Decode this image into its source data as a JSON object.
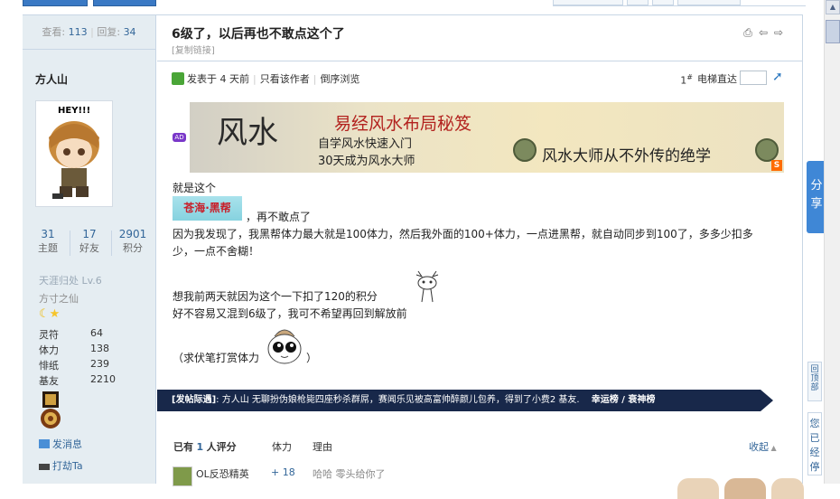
{
  "sidebar": {
    "view_label": "查看:",
    "view_count": "113",
    "reply_label": "回复:",
    "reply_count": "34",
    "username": "方人山",
    "stats": [
      {
        "value": "31",
        "label": "主题"
      },
      {
        "value": "17",
        "label": "好友"
      },
      {
        "value": "2901",
        "label": "积分"
      }
    ],
    "level": "天涯归处 Lv.6",
    "custom_title": "方寸之仙",
    "properties": [
      {
        "name": "灵符",
        "value": "64"
      },
      {
        "name": "体力",
        "value": "138"
      },
      {
        "name": "悱纸",
        "value": "239"
      },
      {
        "name": "基友",
        "value": "2210"
      }
    ],
    "send_message": "发消息",
    "poke": "打劫Ta"
  },
  "post": {
    "title": "6级了，以后再也不敢点这个了",
    "copy_link": "[复制链接]",
    "posted": "发表于 4 天前",
    "only_author": "只看该作者",
    "reverse": "倒序浏览",
    "floor_num": "1",
    "floor_sup": "#",
    "elevator_label": "电梯直达",
    "banner": {
      "ink": "风水",
      "line1": "易经风水布局秘笈",
      "line2": "自学风水快速入门",
      "line3": "30天成为风水大师",
      "line4": "风水大师从不外传的绝学",
      "ad_tag": "AD",
      "sponsor_mark": "S"
    },
    "body": {
      "p1": "就是这个",
      "tag_image_text": "苍海·黑帮",
      "p2": "，再不敢点了",
      "p3": "因为我发现了，我黑帮体力最大就是100体力，然后我外面的100+体力，一点进黑帮，就自动同步到100了，多多少扣多",
      "p3b": "少，一点不舍糊！",
      "p4": "想我前两天就因为这个一下扣了120的积分",
      "p5": "好不容易又混到6级了，我可不希望再回到解放前",
      "p6a": "（求伏笔打赏体力",
      "p6b": "）"
    },
    "signature": {
      "label": "[发帖际遇]",
      "text": ": 方人山 无聊扮伪娘枪毙四座秒杀群屌，赛闻乐见被高富帅醉颜儿包养，得到了小费2 基友.",
      "links": "幸运榜 / 衰神榜"
    },
    "rating": {
      "prefix": "已有",
      "count": "1",
      "suffix": "人评分",
      "col_tili": "体力",
      "col_reason": "理由",
      "collapse": "收起",
      "row_user": "OL反恐精英",
      "row_tili": "+ 18",
      "row_reason": "哈哈 零头给你了"
    }
  },
  "right": {
    "share": "分享",
    "back_top": "回顶部",
    "history": "您已经停"
  },
  "colors": {
    "accent_blue": "#3a79c4",
    "link": "#336699",
    "signature_bg": "#18284a",
    "share_bg": "#3f87d6"
  }
}
